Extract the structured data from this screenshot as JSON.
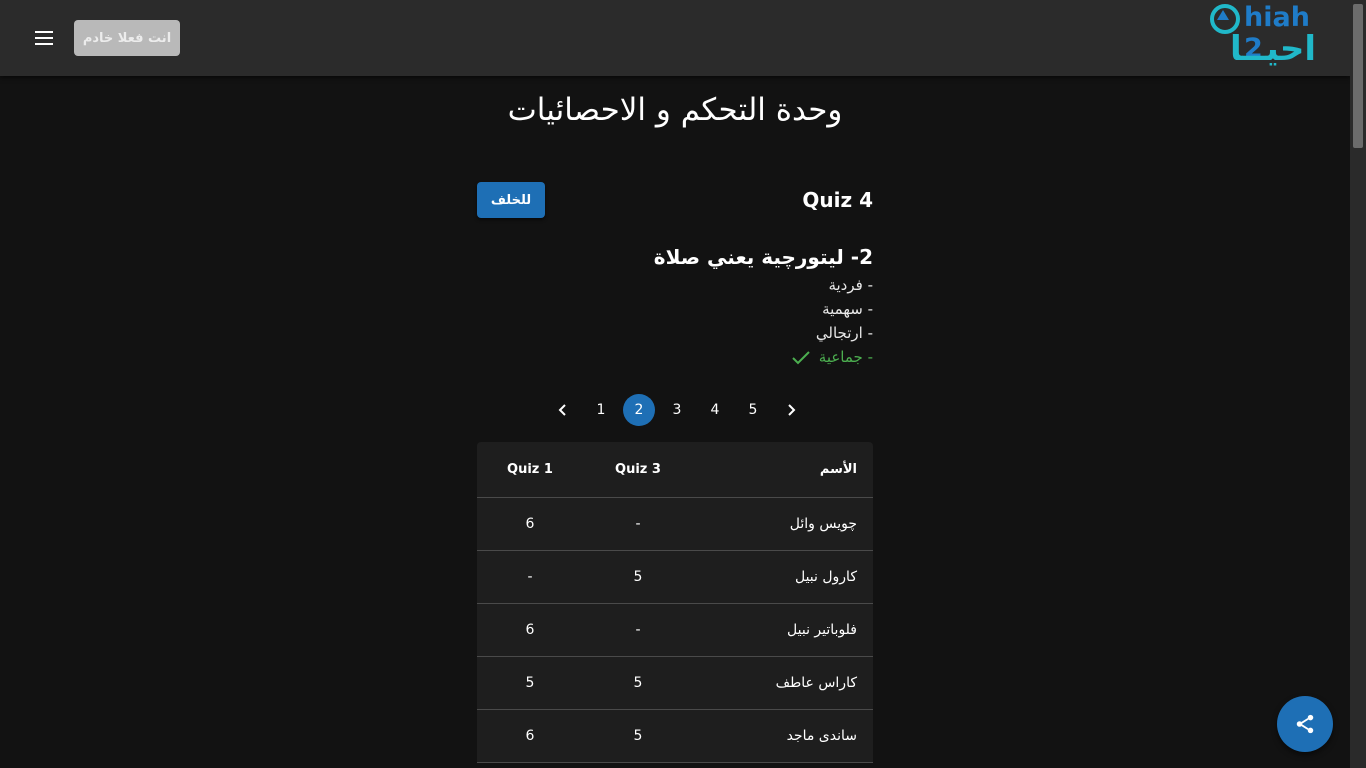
{
  "header": {
    "servant_button": "انت فعلا خادم",
    "logo_latin": "hiah 2",
    "logo_arabic": "احيــا",
    "brand_colors": {
      "blue": "#1f7cc8",
      "teal": "#20b8c9"
    }
  },
  "page": {
    "title": "وحدة التحكم و الاحصائيات",
    "quiz_title": "Quiz 4",
    "back_button": "للخلف"
  },
  "question": {
    "text": "2- ليتورچية يعني صلاة",
    "options": [
      {
        "label": "- فردية",
        "correct": false
      },
      {
        "label": "- سهمية",
        "correct": false
      },
      {
        "label": "- ارتجالي",
        "correct": false
      },
      {
        "label": "- جماعية",
        "correct": true
      }
    ],
    "correct_color": "#4caf50"
  },
  "pagination": {
    "pages": [
      "1",
      "2",
      "3",
      "4",
      "5"
    ],
    "current": "2",
    "accent": "#1e6fb5"
  },
  "table": {
    "headers": {
      "name": "الأسم",
      "q3": "Quiz 3",
      "q1": "Quiz 1"
    },
    "rows": [
      {
        "name": "چويس وائل",
        "q3": "-",
        "q1": "6"
      },
      {
        "name": "كارول نبيل",
        "q3": "5",
        "q1": "-"
      },
      {
        "name": "فلوباتير نبيل",
        "q3": "-",
        "q1": "6"
      },
      {
        "name": "كاراس عاطف",
        "q3": "5",
        "q1": "5"
      },
      {
        "name": "ساندى ماجد",
        "q3": "5",
        "q1": "6"
      }
    ]
  },
  "icons": {
    "menu": "menu-icon",
    "check": "check-icon",
    "prev": "chevron-left-icon",
    "next": "chevron-right-icon",
    "share": "share-icon"
  }
}
